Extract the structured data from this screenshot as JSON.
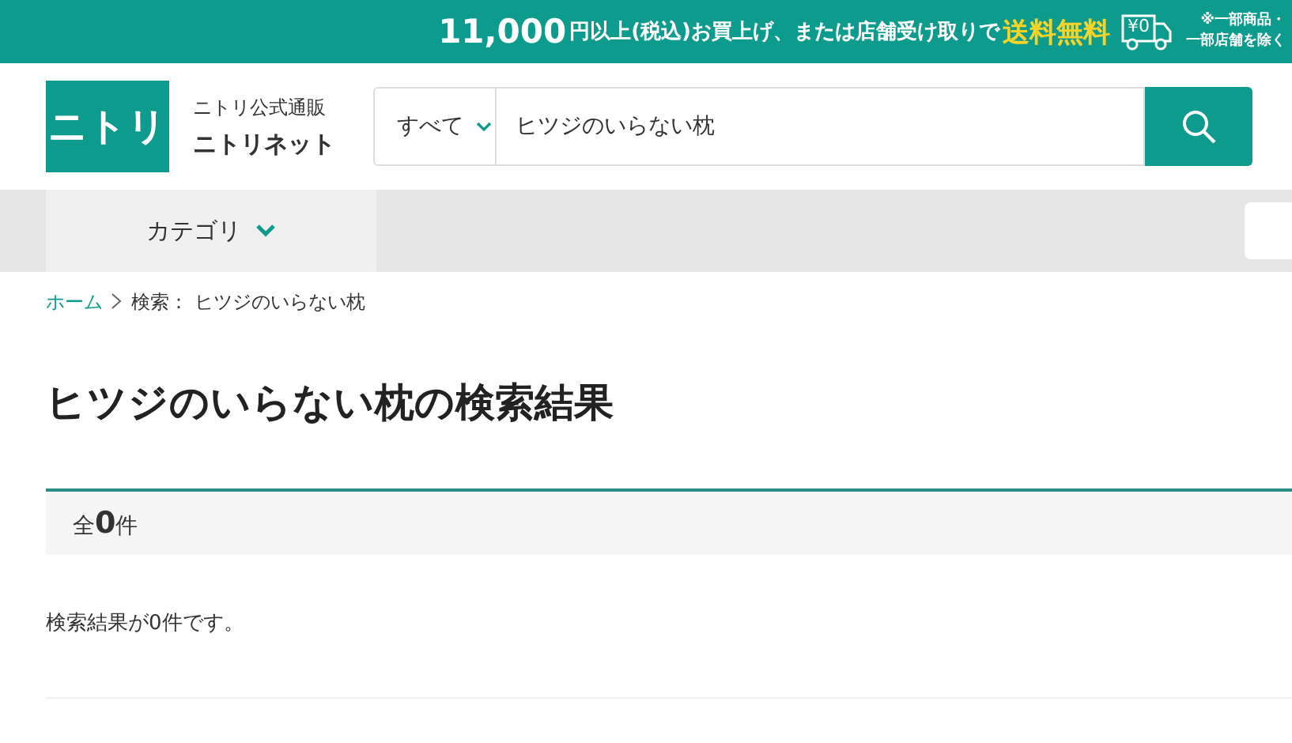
{
  "banner": {
    "amount": "11,000",
    "text": "円以上(税込)お買上げ、または店舗受け取りで",
    "highlight": "送料無料",
    "icon_label": "¥0",
    "note": [
      "※一部商品・",
      "一部店舗を除く"
    ]
  },
  "header": {
    "logo": "ニトリ",
    "tagline": "ニトリ公式通販",
    "site_name": "ニトリネット",
    "search": {
      "scope": "すべて",
      "value": "ヒツジのいらない枕"
    }
  },
  "nav": {
    "category": "カテゴリ"
  },
  "breadcrumb": [
    {
      "label": "ホーム",
      "kind": "link"
    },
    {
      "label": "検索： ヒツジのいらない枕",
      "kind": "text"
    }
  ],
  "title": "ヒツジのいらない枕の検索結果",
  "count": "全**0**件",
  "message": "検索結果が0件です。"
}
